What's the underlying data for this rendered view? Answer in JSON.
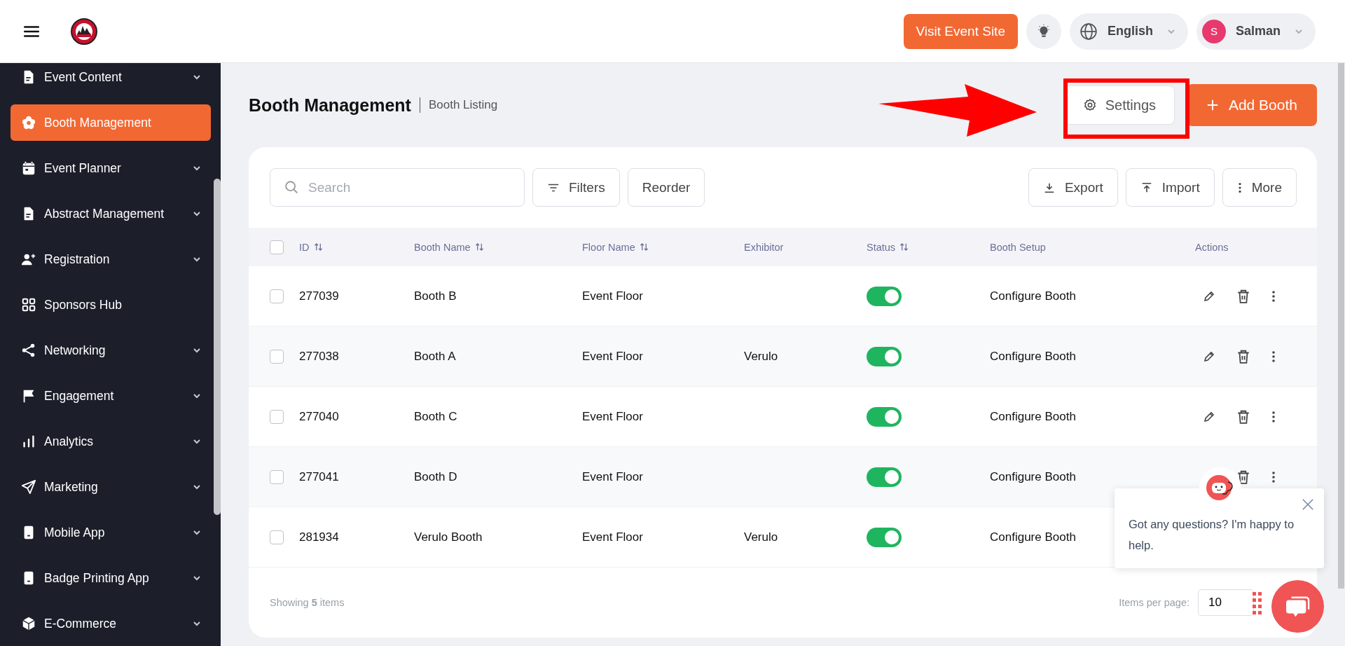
{
  "header": {
    "visit_button": "Visit Event Site",
    "language": "English",
    "user_initial": "S",
    "user_name": "Salman"
  },
  "sidebar": {
    "items": [
      {
        "label": "Event Content",
        "has_submenu": true,
        "selected": false
      },
      {
        "label": "Booth Management",
        "has_submenu": false,
        "selected": true
      },
      {
        "label": "Event Planner",
        "has_submenu": true,
        "selected": false
      },
      {
        "label": "Abstract Management",
        "has_submenu": true,
        "selected": false
      },
      {
        "label": "Registration",
        "has_submenu": true,
        "selected": false
      },
      {
        "label": "Sponsors Hub",
        "has_submenu": false,
        "selected": false
      },
      {
        "label": "Networking",
        "has_submenu": true,
        "selected": false
      },
      {
        "label": "Engagement",
        "has_submenu": true,
        "selected": false
      },
      {
        "label": "Analytics",
        "has_submenu": true,
        "selected": false
      },
      {
        "label": "Marketing",
        "has_submenu": true,
        "selected": false
      },
      {
        "label": "Mobile App",
        "has_submenu": true,
        "selected": false
      },
      {
        "label": "Badge Printing App",
        "has_submenu": true,
        "selected": false
      },
      {
        "label": "E-Commerce",
        "has_submenu": true,
        "selected": false
      }
    ]
  },
  "page": {
    "title": "Booth Management",
    "breadcrumb": "Booth Listing",
    "settings_button": "Settings",
    "add_button": "Add Booth"
  },
  "toolbar": {
    "search_placeholder": "Search",
    "left_buttons": [
      "Filters",
      "Reorder"
    ],
    "right_buttons": [
      "Export",
      "Import",
      "More"
    ]
  },
  "table": {
    "select_all_checked": false,
    "columns": [
      {
        "label": "ID",
        "sortable": true
      },
      {
        "label": "Booth Name",
        "sortable": true
      },
      {
        "label": "Floor Name",
        "sortable": true
      },
      {
        "label": "Exhibitor",
        "sortable": false
      },
      {
        "label": "Status",
        "sortable": true
      },
      {
        "label": "Booth Setup",
        "sortable": false
      },
      {
        "label": "Actions",
        "sortable": false
      }
    ],
    "rows": [
      {
        "checked": false,
        "id": "277039",
        "booth_name": "Booth B",
        "floor_name": "Event Floor",
        "exhibitor": "",
        "status": true,
        "setup": "Configure Booth"
      },
      {
        "checked": false,
        "id": "277038",
        "booth_name": "Booth A",
        "floor_name": "Event Floor",
        "exhibitor": "Verulo",
        "status": true,
        "setup": "Configure Booth"
      },
      {
        "checked": false,
        "id": "277040",
        "booth_name": "Booth C",
        "floor_name": "Event Floor",
        "exhibitor": "",
        "status": true,
        "setup": "Configure Booth"
      },
      {
        "checked": false,
        "id": "277041",
        "booth_name": "Booth D",
        "floor_name": "Event Floor",
        "exhibitor": "",
        "status": true,
        "setup": "Configure Booth"
      },
      {
        "checked": false,
        "id": "281934",
        "booth_name": "Verulo Booth",
        "floor_name": "Event Floor",
        "exhibitor": "Verulo",
        "status": true,
        "setup": "Configure Booth"
      }
    ]
  },
  "footer": {
    "showing": "Showing **5** items",
    "items_per_page_label": "Items per page:",
    "items_per_page": "10"
  },
  "chat": {
    "message": "Got any questions? I'm happy to help."
  }
}
